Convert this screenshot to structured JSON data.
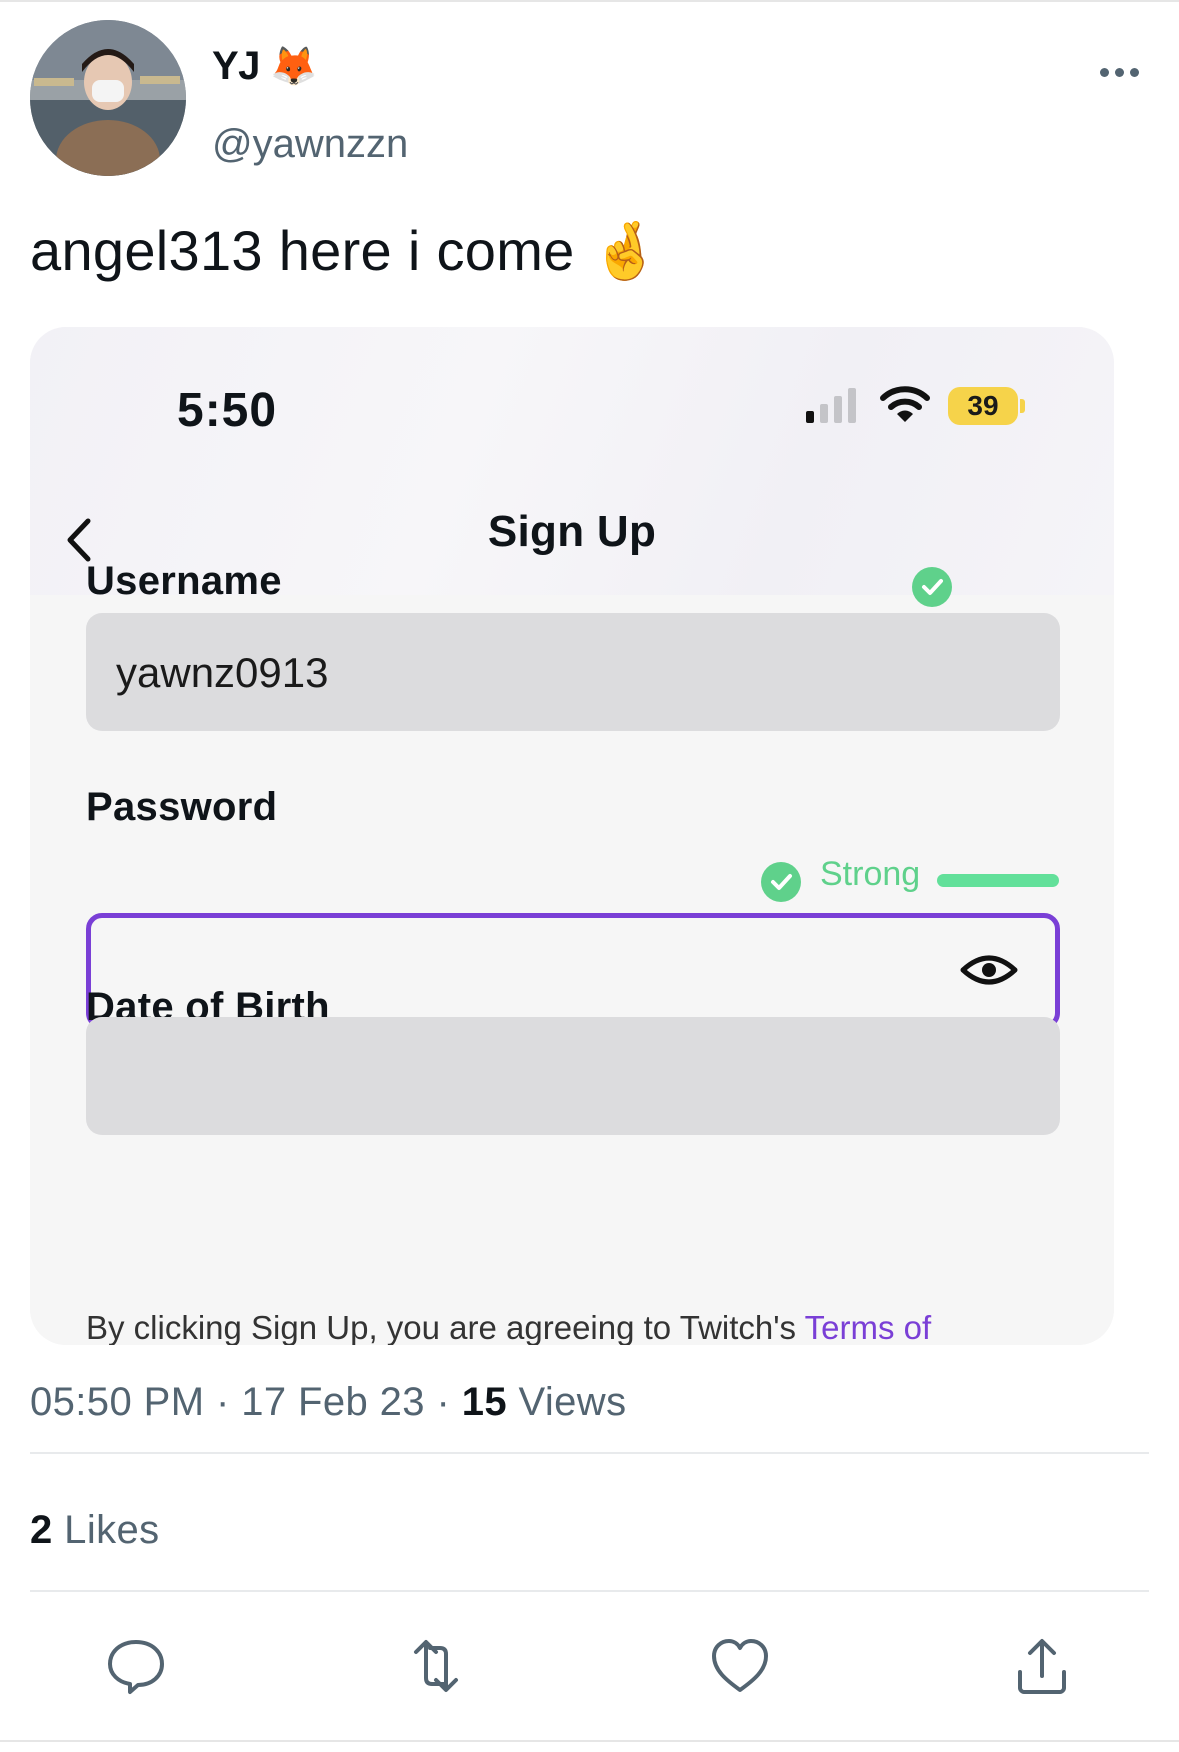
{
  "tweet": {
    "author_name": "YJ",
    "author_emoji": "🦊",
    "handle": "@yawnzzn",
    "text": "angel313 here i come 🤞",
    "time": "05:50 PM",
    "date": "17 Feb 23",
    "views_count": "15",
    "views_label": "Views",
    "likes_count": "2",
    "likes_label": "Likes"
  },
  "screenshot": {
    "status_time": "5:50",
    "battery": "39",
    "title": "Sign Up",
    "username_label": "Username",
    "username_value": "yawnz0913",
    "password_label": "Password",
    "password_strength": "Strong",
    "dob_label": "Date of Birth",
    "terms_text": "By clicking Sign Up, you are agreeing to Twitch's ",
    "terms_link": "Terms of"
  },
  "colors": {
    "accent_purple": "#7a3fd6",
    "success_green": "#5fd18b",
    "battery_yellow": "#f6d34a"
  },
  "icons": {
    "more": "more-horizontal-icon",
    "reply": "reply-icon",
    "retweet": "retweet-icon",
    "like": "heart-icon",
    "share": "share-icon",
    "back": "chevron-left-icon",
    "eye": "eye-icon",
    "check": "check-circle-icon"
  }
}
